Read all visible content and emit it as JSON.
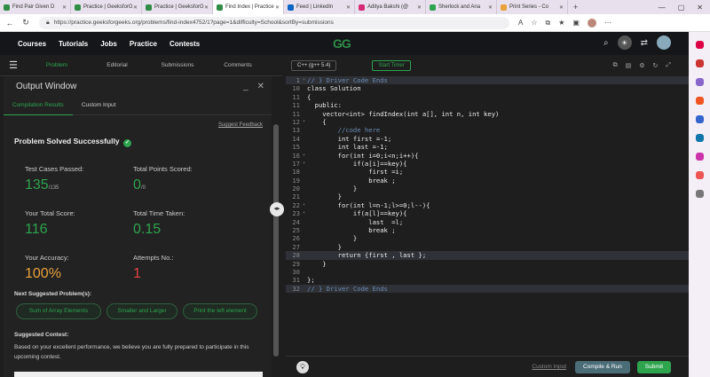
{
  "browser": {
    "tabs": [
      {
        "label": "Find Pair Given D",
        "color": "#2f8d46"
      },
      {
        "label": "Practice | GeeksforG",
        "color": "#2f8d46"
      },
      {
        "label": "Practice | GeeksforG",
        "color": "#2f8d46"
      },
      {
        "label": "Find Index | Practice",
        "color": "#2f8d46"
      },
      {
        "label": "Feed | LinkedIn",
        "color": "#0a66c2"
      },
      {
        "label": "Aditya Bakshi (@",
        "color": "#d62976"
      },
      {
        "label": "Sherlock and Ana",
        "color": "#2ea44f"
      },
      {
        "label": "Print Series - Co",
        "color": "#e8a33d"
      }
    ],
    "url": "https://practice.geeksforgeeks.org/problems/find-index4752/1?page=1&difficulty=School&sortBy=submissions"
  },
  "header": {
    "menu": [
      "Courses",
      "Tutorials",
      "Jobs",
      "Practice",
      "Contests"
    ],
    "logo": "GG"
  },
  "problem_tabs": [
    "Problem",
    "Editorial",
    "Submissions",
    "Comments"
  ],
  "output": {
    "title": "Output Window",
    "tabs": [
      "Compilation Results",
      "Custom Input"
    ],
    "feedback": "Suggest Feedback",
    "status": "Problem Solved Successfully",
    "stats": {
      "tc_label": "Test Cases Passed:",
      "tc_value": "135",
      "tc_total": "/135",
      "pts_label": "Total Points Scored:",
      "pts_value": "0",
      "pts_total": "/0",
      "score_label": "Your Total Score:",
      "score_value": "116",
      "time_label": "Total Time Taken:",
      "time_value": "0.15",
      "acc_label": "Your Accuracy:",
      "acc_value": "100%",
      "att_label": "Attempts No.:",
      "att_value": "1"
    },
    "next_label": "Next Suggested Problem(s):",
    "suggestions": [
      "Sum of Array Elements",
      "Smaller and Larger",
      "Print the left element"
    ],
    "contest_label": "Suggested Contest:",
    "contest_text": "Based on your excellent performance, we believe you are fully prepared to participate in this upcoming contest."
  },
  "editor": {
    "language": "C++ (g++ 5.4)",
    "timer": "Start Timer",
    "lines": [
      {
        "n": "1",
        "t": "// } Driver Code Ends"
      },
      {
        "n": "10",
        "t": "class Solution"
      },
      {
        "n": "11",
        "t": "{"
      },
      {
        "n": "11",
        "t": "  public:"
      },
      {
        "n": "11",
        "t": "    vector<int> findIndex(int a[], int n, int key)"
      },
      {
        "n": "12",
        "t": "    {"
      },
      {
        "n": "13",
        "t": "        //code here"
      },
      {
        "n": "14",
        "t": "        int first =-1;"
      },
      {
        "n": "15",
        "t": "        int last =-1;"
      },
      {
        "n": "16",
        "t": "        for(int i=0;i<n;i++){"
      },
      {
        "n": "17",
        "t": "            if(a[i]==key){"
      },
      {
        "n": "18",
        "t": "                first =i;"
      },
      {
        "n": "19",
        "t": "                break ;"
      },
      {
        "n": "20",
        "t": "            }"
      },
      {
        "n": "21",
        "t": "        }"
      },
      {
        "n": "22",
        "t": "        for(int l=n-1;l>=0;l--){"
      },
      {
        "n": "23",
        "t": "            if(a[l]==key){"
      },
      {
        "n": "24",
        "t": "                last  =l;"
      },
      {
        "n": "25",
        "t": "                break ;"
      },
      {
        "n": "26",
        "t": "            }"
      },
      {
        "n": "27",
        "t": "        }"
      },
      {
        "n": "28",
        "t": "        return {first , last };"
      },
      {
        "n": "29",
        "t": "    }"
      },
      {
        "n": "30",
        "t": ""
      },
      {
        "n": "31",
        "t": "};"
      },
      {
        "n": "32",
        "t": "// } Driver Code Ends"
      }
    ],
    "custom_input": "Custom Input",
    "compile": "Compile & Run",
    "submit": "Submit"
  }
}
